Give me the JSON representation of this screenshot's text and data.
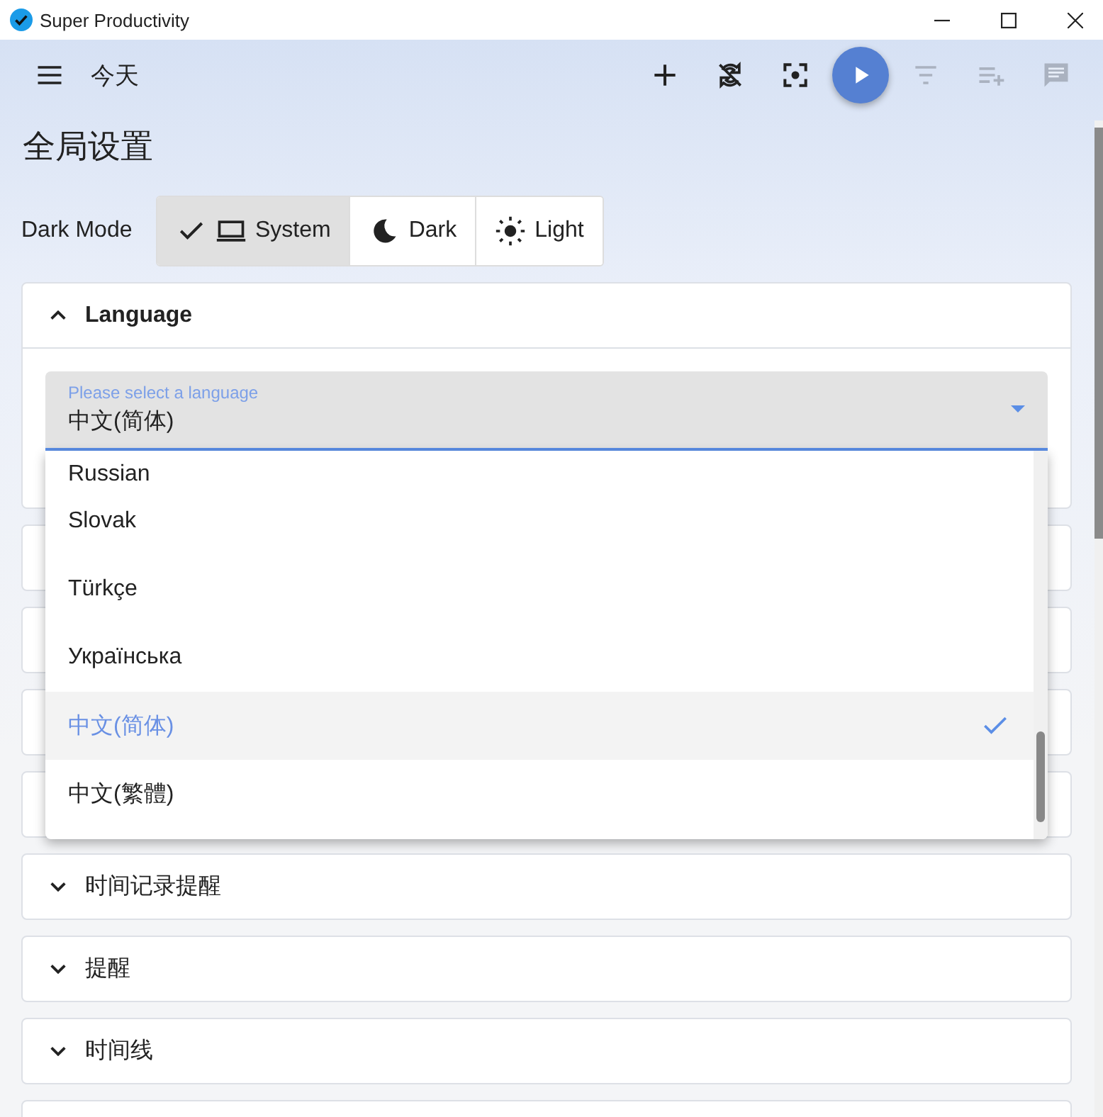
{
  "window": {
    "title": "Super Productivity"
  },
  "header": {
    "title": "今天",
    "actions": [
      {
        "kind": "add",
        "disabled": false
      },
      {
        "kind": "sync",
        "disabled": false
      },
      {
        "kind": "focus",
        "disabled": false
      },
      {
        "kind": "play",
        "disabled": false
      },
      {
        "kind": "filter",
        "disabled": true
      },
      {
        "kind": "add-list",
        "disabled": true
      },
      {
        "kind": "comment",
        "disabled": true
      }
    ]
  },
  "page_title": "全局设置",
  "dark_mode": {
    "label": "Dark Mode",
    "options": [
      {
        "kind": "system",
        "label": "System",
        "selected": true
      },
      {
        "kind": "dark",
        "label": "Dark",
        "selected": false
      },
      {
        "kind": "light",
        "label": "Light",
        "selected": false
      }
    ]
  },
  "language_panel": {
    "title": "Language",
    "expanded": true,
    "select": {
      "placeholder": "Please select a language",
      "value": "中文(简体)"
    },
    "options": [
      {
        "label": "Russian",
        "selected": false
      },
      {
        "label": "Slovak",
        "selected": false
      },
      {
        "label": "Türkçe",
        "selected": false
      },
      {
        "label": "Українська",
        "selected": false
      },
      {
        "label": "中文(简体)",
        "selected": true
      },
      {
        "label": "中文(繁體)",
        "selected": false
      }
    ]
  },
  "panels": [
    {
      "title": "时间记录提醒",
      "expanded": false
    },
    {
      "title": "提醒",
      "expanded": false
    },
    {
      "title": "时间线",
      "expanded": false
    }
  ]
}
